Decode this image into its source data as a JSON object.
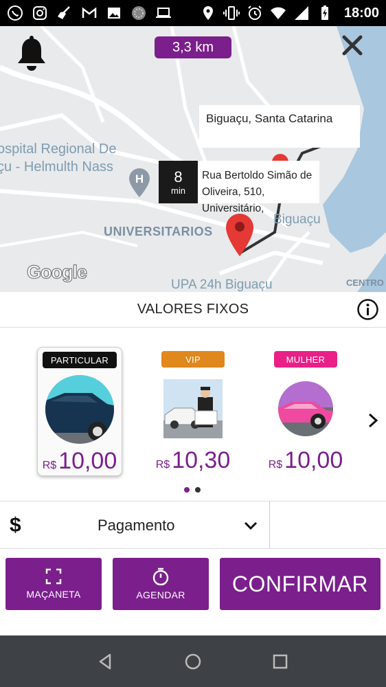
{
  "status_bar": {
    "time": "18:00",
    "icons": [
      "whatsapp-icon",
      "instagram-icon",
      "broom-icon",
      "gmail-icon",
      "image-icon",
      "sphere-icon",
      "laptop-icon",
      "location-icon",
      "vibrate-icon",
      "alarm-icon",
      "wifi-icon",
      "signal-icon",
      "battery-charging-icon"
    ]
  },
  "map": {
    "distance": "3,3 km",
    "destination": "Biguaçu, Santa Catarina",
    "eta_value": "8",
    "eta_unit": "min",
    "origin_address": "Rua Bertoldo Simão de Oliveira, 510, Universitário,",
    "labels": {
      "hospital_line1": "ospital Regional De",
      "hospital_line2": "çu - Helmulth Nass",
      "neighborhood": "UNIVERSITARIOS",
      "city": "Biguaçu",
      "upa": "UPA 24h Biguaçu",
      "centro": "CENTRO"
    },
    "google_logo": "Google"
  },
  "fixed_values": {
    "title": "VALORES FIXOS"
  },
  "categories": [
    {
      "badge": "PARTICULAR",
      "badge_color": "#111111",
      "currency": "R$",
      "price": "10,00",
      "selected": true
    },
    {
      "badge": "VIP",
      "badge_color": "#e0871d",
      "currency": "R$",
      "price": "10,30",
      "selected": false
    },
    {
      "badge": "MULHER",
      "badge_color": "#ea1f87",
      "currency": "R$",
      "price": "10,00",
      "selected": false
    }
  ],
  "pager": {
    "pages": 2,
    "current": 1
  },
  "payment": {
    "icon": "$",
    "label": "Pagamento"
  },
  "actions": {
    "macaneta": "MAÇANETA",
    "agendar": "AGENDAR",
    "confirmar": "CONFIRMAR"
  },
  "colors": {
    "accent": "#7b1f8c",
    "nav_bar": "#3e4145"
  }
}
